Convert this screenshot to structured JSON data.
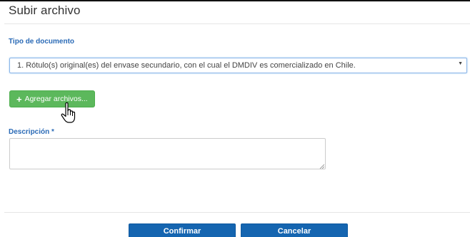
{
  "modal": {
    "title": "Subir archivo"
  },
  "document_type": {
    "label": "Tipo de documento",
    "selected": "1. Rótulo(s) original(es) del envase secundario, con el cual el DMDIV es comercializado en Chile."
  },
  "upload": {
    "button_label": "Agregar archivos..."
  },
  "description": {
    "label": "Descripción *",
    "value": ""
  },
  "footer": {
    "confirm_label": "Confirmar",
    "cancel_label": "Cancelar"
  },
  "icons": {
    "add": "plus-icon",
    "dropdown": "caret-down-icon",
    "pointer": "hand-pointer-icon",
    "resize": "resize-grip-icon"
  },
  "colors": {
    "label_blue": "#2a6ab6",
    "add_green": "#5cb85c",
    "primary_blue": "#1565b0"
  }
}
